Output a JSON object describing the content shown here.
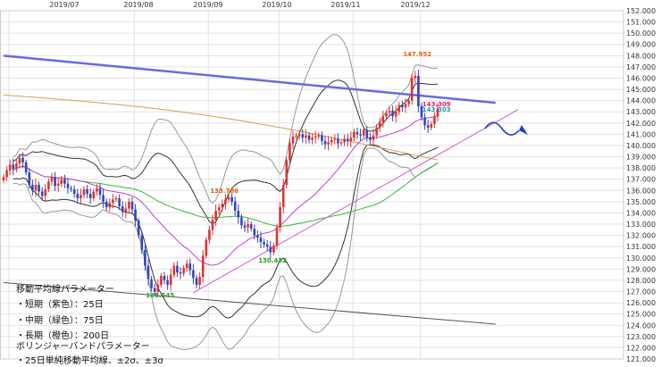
{
  "chart_data": {
    "type": "candlestick",
    "x_ticks": [
      "2019/07",
      "2019/08",
      "2019/09",
      "2019/10",
      "2019/11",
      "2019/12"
    ],
    "ylim": [
      121,
      152
    ],
    "y_ticks": [
      "121.000",
      "122.000",
      "123.000",
      "124.000",
      "125.000",
      "126.000",
      "127.000",
      "128.000",
      "129.000",
      "130.000",
      "131.000",
      "132.000",
      "133.000",
      "134.000",
      "135.000",
      "136.000",
      "137.000",
      "138.000",
      "139.000",
      "140.000",
      "141.000",
      "142.000",
      "143.000",
      "144.000",
      "145.000",
      "146.000",
      "147.000",
      "148.000",
      "149.000",
      "150.000",
      "151.000",
      "152.000"
    ],
    "grid": true,
    "closes": [
      137.2,
      137.8,
      138.3,
      137.9,
      138.4,
      138.9,
      138.5,
      137.6,
      136.5,
      136.0,
      136.5,
      135.9,
      135.5,
      136.1,
      136.8,
      137.2,
      136.4,
      136.6,
      137.0,
      136.6,
      136.2,
      136.1,
      135.7,
      135.3,
      135.6,
      136.1,
      135.7,
      135.3,
      135.9,
      136.2,
      135.6,
      135.0,
      134.5,
      134.9,
      135.2,
      135.3,
      134.6,
      134.1,
      134.4,
      135.0,
      134.3,
      133.3,
      132.0,
      130.7,
      129.3,
      128.1,
      127.3,
      127.0,
      127.6,
      128.4,
      128.0,
      127.6,
      128.5,
      129.3,
      128.7,
      128.6,
      129.1,
      129.5,
      128.9,
      128.2,
      127.6,
      128.3,
      130.2,
      131.6,
      132.5,
      133.4,
      134.2,
      134.5,
      134.8,
      135.2,
      135.4,
      135.0,
      134.2,
      133.6,
      132.9,
      132.7,
      133.0,
      132.6,
      132.0,
      131.8,
      131.4,
      131.2,
      131.0,
      130.5,
      131.1,
      132.7,
      134.5,
      136.5,
      138.7,
      140.2,
      140.8,
      140.9,
      141.0,
      140.7,
      140.9,
      140.5,
      140.7,
      140.8,
      140.9,
      140.4,
      140.1,
      140.3,
      140.5,
      140.6,
      140.2,
      140.3,
      140.6,
      140.4,
      140.7,
      141.2,
      141.0,
      140.9,
      141.4,
      140.7,
      140.5,
      140.9,
      141.6,
      142.1,
      142.6,
      142.9,
      143.1,
      142.6,
      143.0,
      143.6,
      143.4,
      143.7,
      144.0,
      146.0,
      146.2,
      143.5,
      142.5,
      141.8,
      141.6,
      141.9,
      142.6,
      143.3
    ],
    "series": [
      {
        "name": "短期（紫色）：25日",
        "type": "moving-average",
        "color": "#c040d0"
      },
      {
        "name": "中期（緑色）：75日",
        "type": "moving-average",
        "color": "#33bb33"
      },
      {
        "name": "長期（橙色）：200日",
        "type": "moving-average",
        "color": "#e09a50"
      },
      {
        "name": "±2σ",
        "type": "bollinger",
        "color": "#333333"
      },
      {
        "name": "±3σ",
        "type": "bollinger",
        "color": "#999999"
      }
    ],
    "annotations": [
      {
        "text": "147.952",
        "color": "#e06010",
        "x_index": 127,
        "y": 147.95
      },
      {
        "text": "133.786",
        "color": "#e06010",
        "x_index": 67,
        "y": 135.8
      },
      {
        "text": "130.432",
        "color": "#20a020",
        "x_index": 82,
        "y": 129.6
      },
      {
        "text": "126.545",
        "color": "#20a020",
        "x_index": 47,
        "y": 126.5
      },
      {
        "text": "143.309",
        "color": "#dd2266",
        "x_index": 133,
        "y": 143.5
      },
      {
        "text": "143.303",
        "color": "#2299aa",
        "x_index": 133,
        "y": 143.0
      }
    ],
    "trendlines": [
      {
        "name": "upper-resistance",
        "color": "#6a6adc",
        "x0": 0,
        "y0": 148.0,
        "x1": 153,
        "y1": 143.8
      },
      {
        "name": "lower-channel",
        "color": "#555555",
        "x0": 0,
        "y0": 127.8,
        "x1": 153,
        "y1": 124.1
      },
      {
        "name": "rising-support",
        "color": "#d060d0",
        "x0": 59,
        "y0": 126.9,
        "x1": 160,
        "y1": 143.2
      }
    ]
  },
  "legend": {
    "title": "移動平均線パラメーター",
    "items": [
      "・短期（紫色）：25日",
      "・中期（緑色）：75日",
      "・長期（橙色）：200日"
    ],
    "bb_title": "ボリンジャーバンドパラメーター",
    "bb_item": "・25日単純移動平均線、±2σ、±3σ"
  },
  "colors": {
    "up": "#dd3333",
    "down": "#3344bb",
    "grid": "#e2e2e2",
    "forecast_arrow": "#1a3fcc"
  }
}
